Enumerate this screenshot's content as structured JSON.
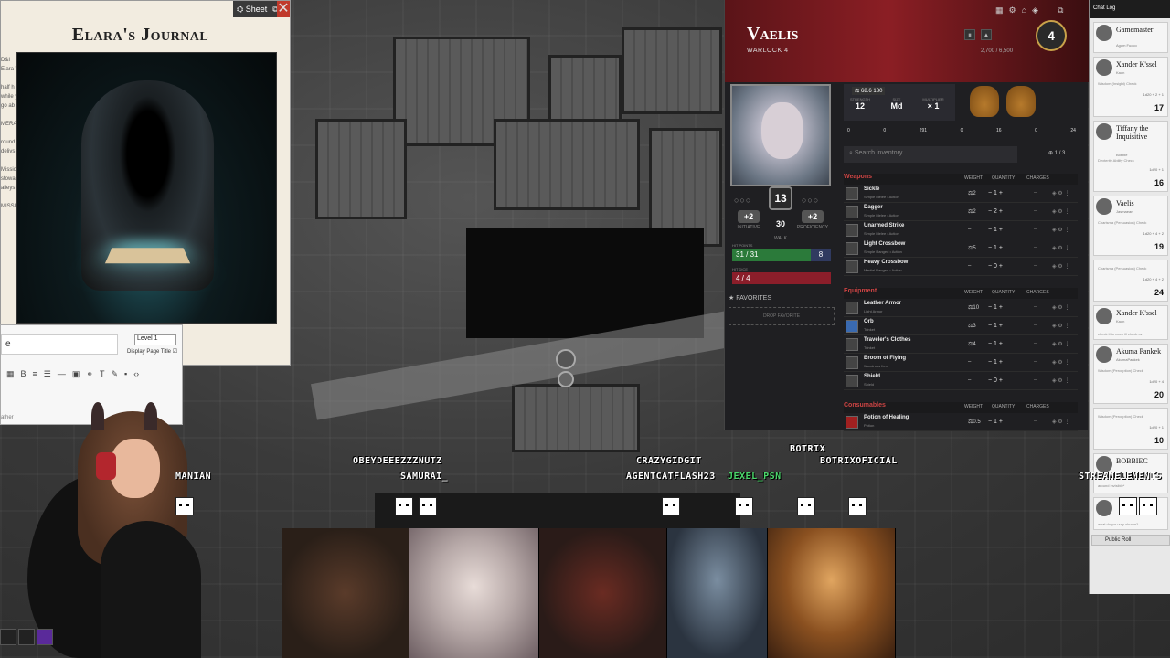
{
  "journal": {
    "title": "Elara's Journal",
    "sheet_btn": "Sheet",
    "level_select": "Level 1",
    "display_title_label": "Display Page Title",
    "side_text": "D&I\nElara W\n\nhalf h\nwhile y\ngo ab\n\nMERA\n\nround\ndelivs\n\nMissio\nstowa\nalleys\n\nMISSIO",
    "editor_value": "e",
    "editor_text": "ather"
  },
  "sheet": {
    "name": "Vaelis",
    "class": "WARLOCK 4",
    "level": "4",
    "xp": "2,700 / 6,500",
    "wealth": "68.6",
    "wealth2": "180",
    "stats": [
      {
        "label": "STRENGTH",
        "value": "12"
      },
      {
        "label": "SIZE",
        "value": "Md"
      },
      {
        "label": "MULTIPLIER",
        "value": "× 1"
      }
    ],
    "coins": [
      "0",
      "0",
      "291",
      "0",
      "16",
      "0",
      "24"
    ],
    "ac": "13",
    "initiative": "+2",
    "initiative_label": "INITIATIVE",
    "proficiency": "+2",
    "proficiency_label": "PROFICIENCY",
    "speed": "30",
    "speed_label": "WALK",
    "hp_label": "HIT POINTS",
    "hp": "31 / 31",
    "temp": "8",
    "hd_label": "HIT DICE",
    "hit_dice": "4 / 4",
    "favorites_label": "FAVORITES",
    "drop_favorite": "DROP FAVORITE",
    "search_placeholder": "Search inventory",
    "pager": "1 / 3",
    "col_weight": "WEIGHT",
    "col_qty": "QUANTITY",
    "col_charges": "CHARGES",
    "weapons_title": "Weapons",
    "weapons": [
      {
        "name": "Sickle",
        "sub": "Simple Melee • Action",
        "w": "2",
        "q": "1"
      },
      {
        "name": "Dagger",
        "sub": "Simple Melee • Action",
        "w": "2",
        "q": "2"
      },
      {
        "name": "Unarmed Strike",
        "sub": "Simple Melee • Action",
        "w": "–",
        "q": "1"
      },
      {
        "name": "Light Crossbow",
        "sub": "Simple Ranged • Action",
        "w": "5",
        "q": "1"
      },
      {
        "name": "Heavy Crossbow",
        "sub": "Martial Ranged • Action",
        "w": "–",
        "q": "0"
      }
    ],
    "equipment_title": "Equipment",
    "equipment": [
      {
        "name": "Leather Armor",
        "sub": "Light Armor",
        "w": "10",
        "q": "1"
      },
      {
        "name": "Orb",
        "sub": "Trinket",
        "w": "3",
        "q": "1"
      },
      {
        "name": "Traveler's Clothes",
        "sub": "Trinket",
        "w": "4",
        "q": "1"
      },
      {
        "name": "Broom of Flying",
        "sub": "Wondrous Item",
        "w": "–",
        "q": "1"
      },
      {
        "name": "Shield",
        "sub": "Shield",
        "w": "–",
        "q": "0"
      }
    ],
    "consumables_title": "Consumables",
    "consumables": [
      {
        "name": "Potion of Healing",
        "sub": "Potion",
        "w": "0.5",
        "q": "1"
      }
    ]
  },
  "chat": {
    "title": "Chat Log",
    "messages": [
      {
        "who": "Gamemaster",
        "sub": "Agom Fuoco",
        "check": "",
        "formula": "",
        "roll": ""
      },
      {
        "who": "Xander K'ssel",
        "sub": "Kaon",
        "check": "Wisdom (Insight) Check",
        "formula": "1d20 + 2 + 1",
        "roll": "17"
      },
      {
        "who": "Tiffany the Inquisitive",
        "sub": "Bobbie",
        "check": "Dexterity Ability Check",
        "formula": "1d20 + 1",
        "roll": "16"
      },
      {
        "who": "Vaelis",
        "sub": "Jasmaean",
        "check": "Charisma (Persuasion) Check",
        "formula": "1d20 + 4 + 2",
        "roll": "19"
      },
      {
        "who": "",
        "sub": "",
        "check": "Charisma (Persuasion) Check",
        "formula": "1d20 + 4 + 2",
        "roll": "24"
      },
      {
        "who": "Xander K'ssel",
        "sub": "Kaon",
        "check": "check this room ill check ov",
        "formula": "",
        "roll": ""
      },
      {
        "who": "Akuma Pankek",
        "sub": "AkumaPankek",
        "check": "Wisdom (Perception) Check",
        "formula": "1d20 + 4",
        "roll": "20"
      },
      {
        "who": "",
        "sub": "",
        "check": "Wisdom (Perception) Check",
        "formula": "1d20 + 1",
        "roll": "10"
      },
      {
        "who": "BOBBIEC",
        "sub": "",
        "check": "around invisible*",
        "formula": "",
        "roll": ""
      },
      {
        "who": "",
        "sub": "",
        "check": "what do you say okuma?",
        "formula": "",
        "roll": ""
      }
    ],
    "public_roll": "Public Roll"
  },
  "stream": {
    "names": [
      {
        "text": "OBEYDEEEZZZNUTZ"
      },
      {
        "text": "SAMURAI_"
      },
      {
        "text": "MANIAN"
      },
      {
        "text": "CRAZYGIDGIT"
      },
      {
        "text": "AGENTCATFLASH23"
      },
      {
        "text": "JEXEL_PSN"
      },
      {
        "text": "BOTRIX"
      },
      {
        "text": "BOTRIXOFICIAL"
      },
      {
        "text": "STREAMELEMENTS"
      }
    ],
    "accent": "#4bd66b"
  }
}
